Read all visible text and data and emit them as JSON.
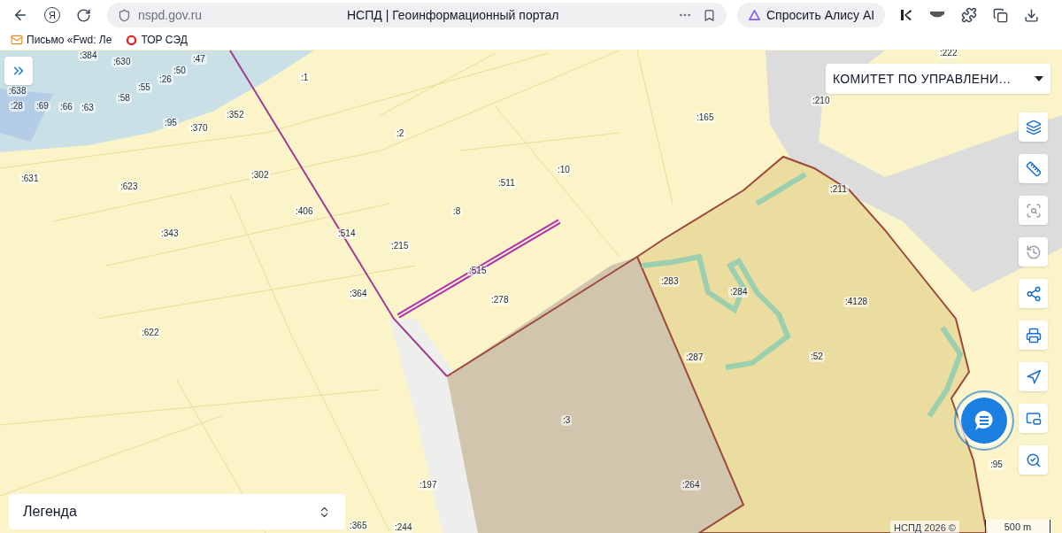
{
  "browser": {
    "logo_letter": "Я",
    "url": "nspd.gov.ru",
    "title": "НСПД | Геоинформационный портал",
    "alice_button": "Спросить Алису AI"
  },
  "bookmarks": [
    {
      "label": "Письмо «Fwd: Ле",
      "kind": "mail"
    },
    {
      "label": "ТОР СЭД",
      "kind": "ring"
    }
  ],
  "map": {
    "layer_select": "КОМИТЕТ ПО УПРАВЛЕНИ…",
    "legend": "Легенда",
    "attribution": "НСПД 2026 ©",
    "scale": "500 m",
    "labels": [
      ":384",
      ":630",
      ":47",
      ":50",
      ":26",
      ":55",
      ":58",
      ":638",
      ":28",
      ":69",
      ":66",
      ":63",
      ":95",
      ":370",
      ":352",
      ":1",
      ":2",
      ":165",
      ":210",
      ":222",
      ":631",
      ":623",
      ":302",
      ":406",
      ":511",
      ":10",
      ":8",
      ":211",
      ":343",
      ":514",
      ":215",
      ":515",
      ":283",
      ":284",
      ":4128",
      ":364",
      ":278",
      ":622",
      ":287",
      ":52",
      ":3",
      ":197",
      ":264",
      ":95",
      ":365",
      ":244"
    ],
    "tools": [
      {
        "kind": "layers",
        "disabled": false
      },
      {
        "kind": "ruler",
        "disabled": false
      },
      {
        "kind": "area-select",
        "disabled": true
      },
      {
        "kind": "history",
        "disabled": true
      },
      {
        "kind": "share",
        "disabled": false
      },
      {
        "kind": "print",
        "disabled": false
      },
      {
        "kind": "locate",
        "disabled": false
      },
      {
        "kind": "picture",
        "disabled": false
      },
      {
        "kind": "geo-search",
        "disabled": false
      }
    ]
  }
}
